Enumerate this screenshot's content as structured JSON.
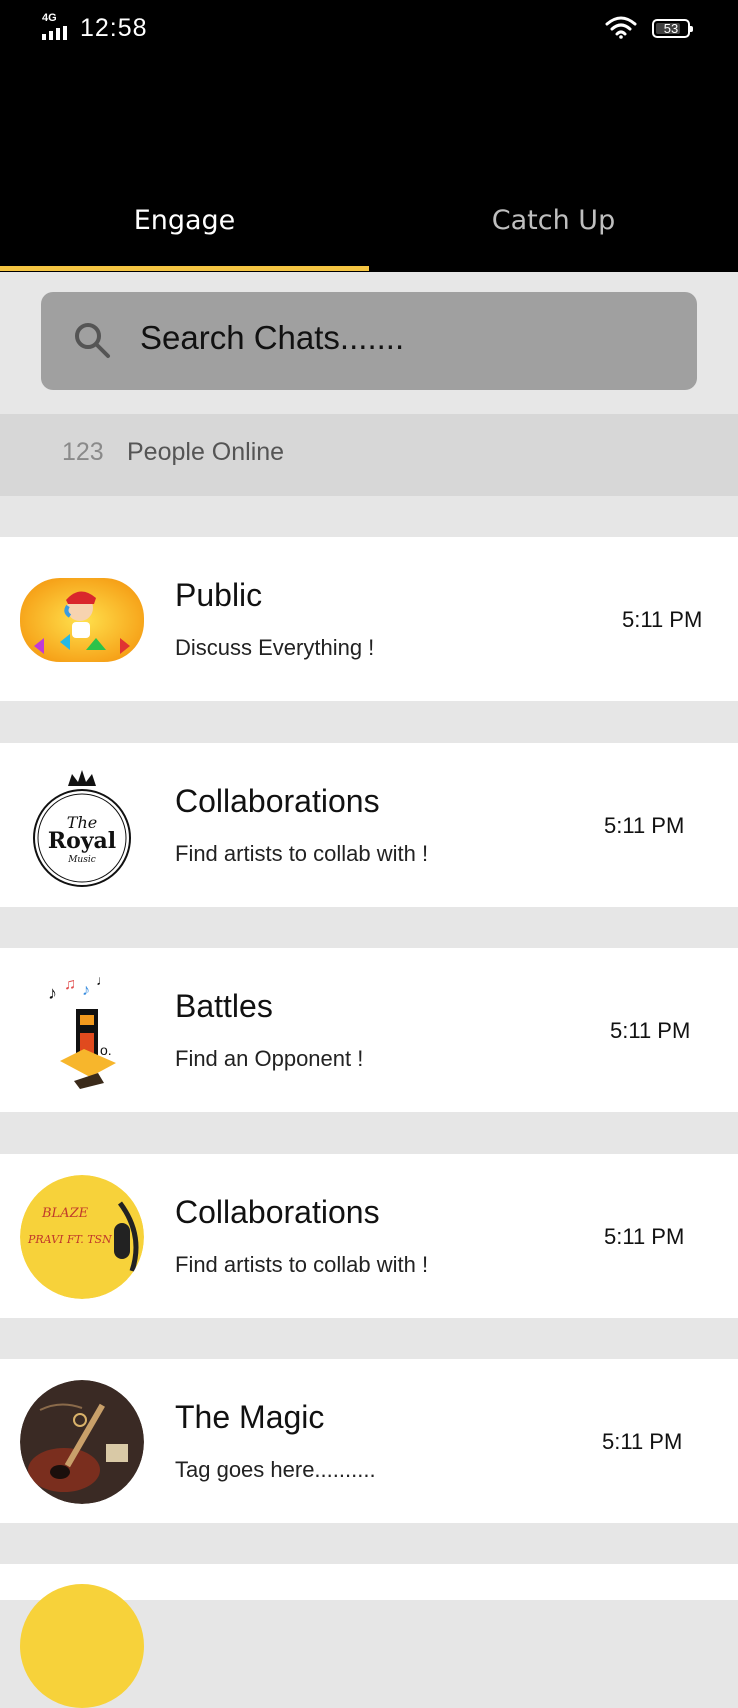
{
  "status_bar": {
    "network": "4G",
    "time": "12:58",
    "battery": "53"
  },
  "tabs": [
    {
      "label": "Engage",
      "active": true
    },
    {
      "label": "Catch Up",
      "active": false
    }
  ],
  "accent_color": "#f5c542",
  "search": {
    "placeholder": "Search Chats......."
  },
  "online": {
    "count": "123",
    "label": "People Online"
  },
  "chats": [
    {
      "title": "Public",
      "subtitle": "Discuss Everything !",
      "time": "5:11 PM",
      "avatar": "cartoon-singer-avatar"
    },
    {
      "title": "Collaborations",
      "subtitle": "Find artists to collab with !",
      "time": "5:11 PM",
      "avatar": "the-royal-music-logo"
    },
    {
      "title": "Battles",
      "subtitle": "Find an Opponent !",
      "time": "5:11 PM",
      "avatar": "music-notes-avatar"
    },
    {
      "title": "Collaborations",
      "subtitle": "Find artists to collab with !",
      "time": "5:11 PM",
      "avatar": "blaze-headphones-avatar",
      "avatar_text_1": "BLAZE",
      "avatar_text_2": "PRAVI FT. TSN"
    },
    {
      "title": "The Magic",
      "subtitle": "Tag goes here..........",
      "time": "5:11 PM",
      "avatar": "guitar-instruments-avatar"
    }
  ]
}
